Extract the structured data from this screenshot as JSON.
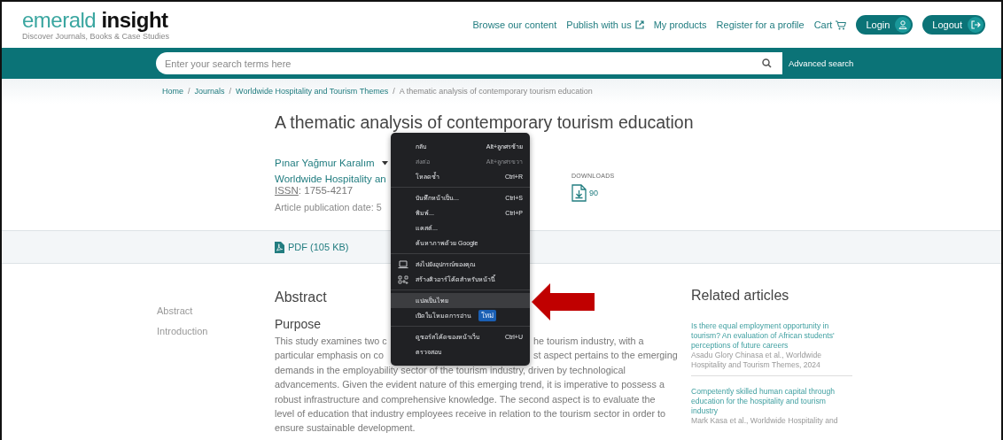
{
  "header": {
    "logo": "emerald **insight**",
    "tagline": "Discover Journals, Books & Case Studies",
    "nav": [
      {
        "label": "Browse our content",
        "kind": "plain"
      },
      {
        "label": "Publish with us",
        "kind": "external"
      },
      {
        "label": "My products",
        "kind": "plain"
      },
      {
        "label": "Register for a profile",
        "kind": "plain"
      },
      {
        "label": "Cart",
        "kind": "cart"
      }
    ],
    "buttons": [
      {
        "label": "Login",
        "kind": "user"
      },
      {
        "label": "Logout",
        "kind": "exit"
      }
    ]
  },
  "search": {
    "placeholder": "Enter your search terms here",
    "advanced": "Advanced search"
  },
  "breadcrumb_separator": "/",
  "breadcrumb": [
    "Home",
    "Journals",
    "Worldwide Hospitality and Tourism Themes",
    "A thematic analysis of contemporary tourism education"
  ],
  "article": {
    "title": "A thematic analysis of contemporary tourism education",
    "author": "Pınar Yağmur Karalım",
    "journal": "Worldwide Hospitality an",
    "issn_label": "ISSN",
    "issn": ": 1755-4217",
    "date": "Article publication date: 5",
    "downloads_label": "DOWNLOADS",
    "downloads": "90",
    "pdf": "PDF (105 KB)"
  },
  "sidebar": [
    "Abstract",
    "Introduction"
  ],
  "abstract": {
    "heading": "Abstract",
    "subheading": "Purpose",
    "lines": [
      {
        "left": "This study examines two c",
        "right": "he tourism industry, with a"
      },
      {
        "left": "particular emphasis on co",
        "right": "st aspect pertains to the emerging"
      },
      {
        "left": "demands in the employability sector of the tourism industry, driven by technological"
      },
      {
        "left": "advancements. Given the evident nature of this emerging trend, it is imperative to possess a"
      },
      {
        "left": "robust infrastructure and comprehensive knowledge. The second aspect is to evaluate the"
      },
      {
        "left": "level of education that industry employees receive in relation to the tourism sector in order to"
      },
      {
        "left": "ensure sustainable development."
      }
    ]
  },
  "related": {
    "heading": "Related articles",
    "items": [
      {
        "title": "Is there equal employment opportunity in tourism? An evaluation of African students' perceptions of future careers",
        "meta": "Asadu Glory Chinasa et al., Worldwide Hospitality and Tourism Themes, 2024"
      },
      {
        "title": "Competently skilled human capital through education for the hospitality and tourism industry",
        "meta": "Mark Kasa et al., Worldwide Hospitality and"
      }
    ]
  },
  "context_menu": {
    "groups": [
      [
        {
          "label": "กลับ",
          "shortcut": "Alt+ลูกศรซ้าย",
          "kind": "plain",
          "disabled": false,
          "selected": false
        },
        {
          "label": "ส่งต่อ",
          "shortcut": "Alt+ลูกศรขวา",
          "kind": "plain",
          "disabled": true,
          "selected": false
        },
        {
          "label": "โหลดซ้ำ",
          "shortcut": "Ctrl+R",
          "kind": "plain",
          "disabled": false,
          "selected": false
        }
      ],
      [
        {
          "label": "บันทึกหน้าเป็น...",
          "shortcut": "Ctrl+S",
          "kind": "plain",
          "disabled": false,
          "selected": false
        },
        {
          "label": "พิมพ์...",
          "shortcut": "Ctrl+P",
          "kind": "plain",
          "disabled": false,
          "selected": false
        },
        {
          "label": "แคสต์...",
          "kind": "plain",
          "disabled": false,
          "selected": false
        },
        {
          "label": "ค้นหาภาพด้วย Google",
          "kind": "plain",
          "disabled": false,
          "selected": false
        }
      ],
      [
        {
          "label": "ส่งไปยังอุปกรณ์ของคุณ",
          "kind": "device",
          "disabled": false,
          "selected": false
        },
        {
          "label": "สร้างคิวอาร์โค้ดสำหรับหน้านี้",
          "kind": "qr",
          "disabled": false,
          "selected": false
        }
      ],
      [
        {
          "label": "แปลเป็นไทย",
          "kind": "plain",
          "disabled": false,
          "selected": true
        },
        {
          "label": "เปิดในโหมดการอ่าน",
          "badge": "ใหม่",
          "kind": "plain",
          "disabled": false,
          "selected": false
        }
      ],
      [
        {
          "label": "ดูซอร์สโค้ดของหน้าเว็บ",
          "shortcut": "Ctrl+U",
          "kind": "plain",
          "disabled": false,
          "selected": false
        },
        {
          "label": "ตรวจสอบ",
          "kind": "plain",
          "disabled": false,
          "selected": false
        }
      ]
    ]
  }
}
